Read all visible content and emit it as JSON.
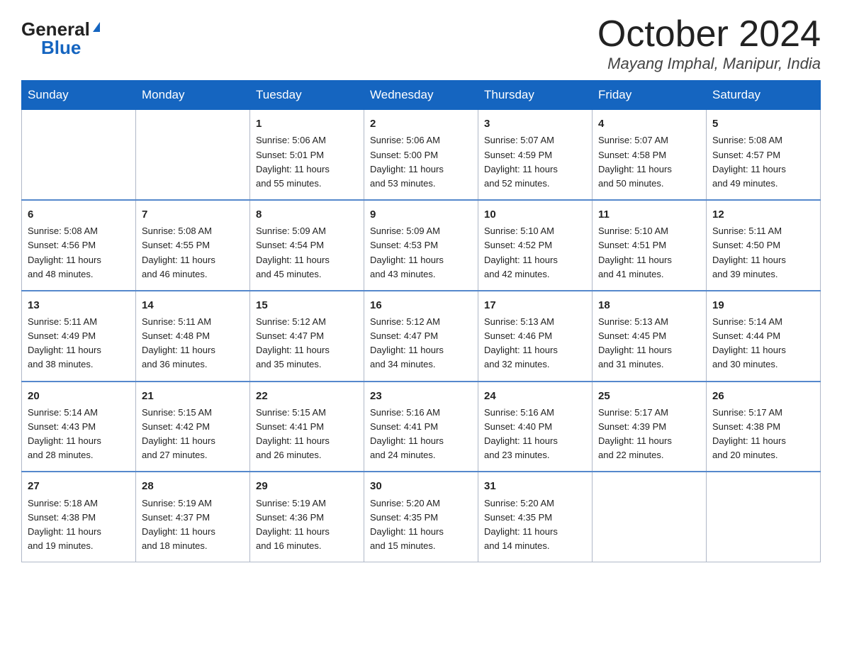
{
  "header": {
    "logo_general": "General",
    "logo_blue": "Blue",
    "month_title": "October 2024",
    "location": "Mayang Imphal, Manipur, India"
  },
  "days_of_week": [
    "Sunday",
    "Monday",
    "Tuesday",
    "Wednesday",
    "Thursday",
    "Friday",
    "Saturday"
  ],
  "weeks": [
    [
      {
        "day": "",
        "info": ""
      },
      {
        "day": "",
        "info": ""
      },
      {
        "day": "1",
        "info": "Sunrise: 5:06 AM\nSunset: 5:01 PM\nDaylight: 11 hours\nand 55 minutes."
      },
      {
        "day": "2",
        "info": "Sunrise: 5:06 AM\nSunset: 5:00 PM\nDaylight: 11 hours\nand 53 minutes."
      },
      {
        "day": "3",
        "info": "Sunrise: 5:07 AM\nSunset: 4:59 PM\nDaylight: 11 hours\nand 52 minutes."
      },
      {
        "day": "4",
        "info": "Sunrise: 5:07 AM\nSunset: 4:58 PM\nDaylight: 11 hours\nand 50 minutes."
      },
      {
        "day": "5",
        "info": "Sunrise: 5:08 AM\nSunset: 4:57 PM\nDaylight: 11 hours\nand 49 minutes."
      }
    ],
    [
      {
        "day": "6",
        "info": "Sunrise: 5:08 AM\nSunset: 4:56 PM\nDaylight: 11 hours\nand 48 minutes."
      },
      {
        "day": "7",
        "info": "Sunrise: 5:08 AM\nSunset: 4:55 PM\nDaylight: 11 hours\nand 46 minutes."
      },
      {
        "day": "8",
        "info": "Sunrise: 5:09 AM\nSunset: 4:54 PM\nDaylight: 11 hours\nand 45 minutes."
      },
      {
        "day": "9",
        "info": "Sunrise: 5:09 AM\nSunset: 4:53 PM\nDaylight: 11 hours\nand 43 minutes."
      },
      {
        "day": "10",
        "info": "Sunrise: 5:10 AM\nSunset: 4:52 PM\nDaylight: 11 hours\nand 42 minutes."
      },
      {
        "day": "11",
        "info": "Sunrise: 5:10 AM\nSunset: 4:51 PM\nDaylight: 11 hours\nand 41 minutes."
      },
      {
        "day": "12",
        "info": "Sunrise: 5:11 AM\nSunset: 4:50 PM\nDaylight: 11 hours\nand 39 minutes."
      }
    ],
    [
      {
        "day": "13",
        "info": "Sunrise: 5:11 AM\nSunset: 4:49 PM\nDaylight: 11 hours\nand 38 minutes."
      },
      {
        "day": "14",
        "info": "Sunrise: 5:11 AM\nSunset: 4:48 PM\nDaylight: 11 hours\nand 36 minutes."
      },
      {
        "day": "15",
        "info": "Sunrise: 5:12 AM\nSunset: 4:47 PM\nDaylight: 11 hours\nand 35 minutes."
      },
      {
        "day": "16",
        "info": "Sunrise: 5:12 AM\nSunset: 4:47 PM\nDaylight: 11 hours\nand 34 minutes."
      },
      {
        "day": "17",
        "info": "Sunrise: 5:13 AM\nSunset: 4:46 PM\nDaylight: 11 hours\nand 32 minutes."
      },
      {
        "day": "18",
        "info": "Sunrise: 5:13 AM\nSunset: 4:45 PM\nDaylight: 11 hours\nand 31 minutes."
      },
      {
        "day": "19",
        "info": "Sunrise: 5:14 AM\nSunset: 4:44 PM\nDaylight: 11 hours\nand 30 minutes."
      }
    ],
    [
      {
        "day": "20",
        "info": "Sunrise: 5:14 AM\nSunset: 4:43 PM\nDaylight: 11 hours\nand 28 minutes."
      },
      {
        "day": "21",
        "info": "Sunrise: 5:15 AM\nSunset: 4:42 PM\nDaylight: 11 hours\nand 27 minutes."
      },
      {
        "day": "22",
        "info": "Sunrise: 5:15 AM\nSunset: 4:41 PM\nDaylight: 11 hours\nand 26 minutes."
      },
      {
        "day": "23",
        "info": "Sunrise: 5:16 AM\nSunset: 4:41 PM\nDaylight: 11 hours\nand 24 minutes."
      },
      {
        "day": "24",
        "info": "Sunrise: 5:16 AM\nSunset: 4:40 PM\nDaylight: 11 hours\nand 23 minutes."
      },
      {
        "day": "25",
        "info": "Sunrise: 5:17 AM\nSunset: 4:39 PM\nDaylight: 11 hours\nand 22 minutes."
      },
      {
        "day": "26",
        "info": "Sunrise: 5:17 AM\nSunset: 4:38 PM\nDaylight: 11 hours\nand 20 minutes."
      }
    ],
    [
      {
        "day": "27",
        "info": "Sunrise: 5:18 AM\nSunset: 4:38 PM\nDaylight: 11 hours\nand 19 minutes."
      },
      {
        "day": "28",
        "info": "Sunrise: 5:19 AM\nSunset: 4:37 PM\nDaylight: 11 hours\nand 18 minutes."
      },
      {
        "day": "29",
        "info": "Sunrise: 5:19 AM\nSunset: 4:36 PM\nDaylight: 11 hours\nand 16 minutes."
      },
      {
        "day": "30",
        "info": "Sunrise: 5:20 AM\nSunset: 4:35 PM\nDaylight: 11 hours\nand 15 minutes."
      },
      {
        "day": "31",
        "info": "Sunrise: 5:20 AM\nSunset: 4:35 PM\nDaylight: 11 hours\nand 14 minutes."
      },
      {
        "day": "",
        "info": ""
      },
      {
        "day": "",
        "info": ""
      }
    ]
  ]
}
